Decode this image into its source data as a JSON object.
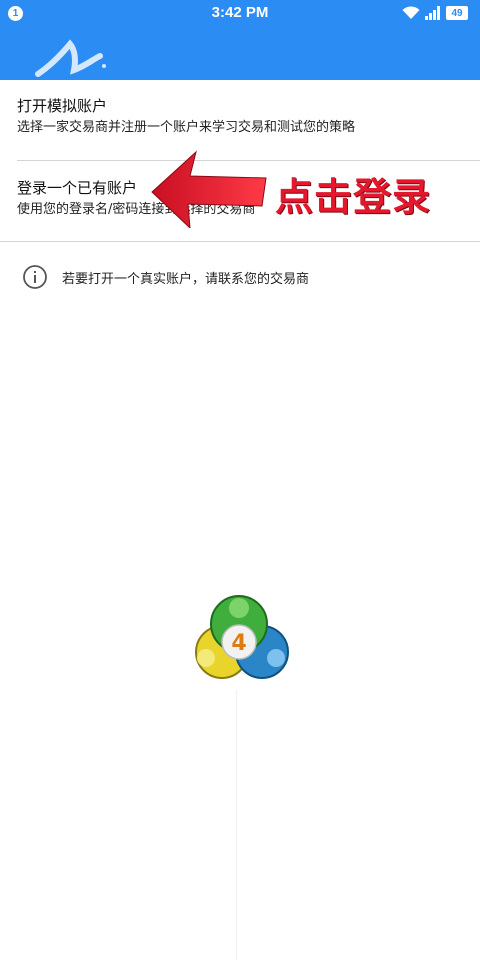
{
  "statusbar": {
    "notification_count": "1",
    "time": "3:42 PM",
    "battery": "49",
    "icons": [
      "wifi-icon",
      "signal-icon",
      "battery-icon"
    ]
  },
  "colors": {
    "toolbar": "#2b8cf3",
    "annotation_red": "#e3182d"
  },
  "options": [
    {
      "title": "打开模拟账户",
      "description": "选择一家交易商并注册一个账户来学习交易和测试您的策略"
    },
    {
      "title": "登录一个已有账户",
      "description": "使用您的登录名/密码连接到选择的交易商"
    }
  ],
  "info": {
    "icon": "info-icon",
    "text": "若要打开一个真实账户，请联系您的交易商"
  },
  "annotation": {
    "text": "点击登录",
    "icon": "red-arrow-icon"
  },
  "logo": {
    "icon": "metatrader-4-logo",
    "number": "4"
  }
}
